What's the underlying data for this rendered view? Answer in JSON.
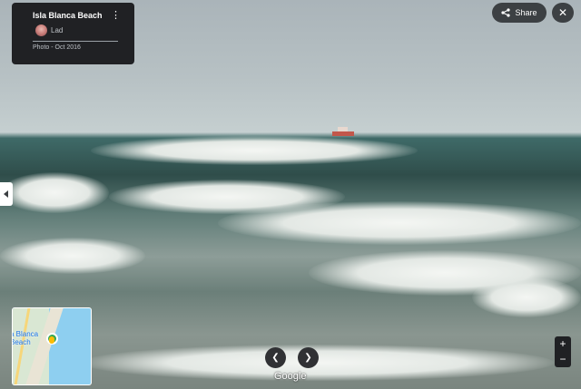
{
  "place": {
    "title": "Isla Blanca Beach",
    "author": "Lad",
    "photo_meta": "Photo - Oct 2016"
  },
  "icons": {
    "menu": "more-vert-icon",
    "share": "share-icon",
    "close": "close-icon",
    "collapse": "chevron-left-icon",
    "prev": "chevron-left-icon",
    "next": "chevron-right-icon"
  },
  "toolbar": {
    "share_label": "Share",
    "close_glyph": "✕",
    "menu_glyph": "⋮"
  },
  "minimap": {
    "label_line1": "a Blanca",
    "label_line2": "Beach"
  },
  "nav": {
    "prev_glyph": "❮",
    "next_glyph": "❯"
  },
  "branding": {
    "watermark": "Google"
  },
  "zoom": {
    "in_glyph": "+",
    "out_glyph": "−"
  },
  "colors": {
    "panel": "#202124",
    "button": "#3c4043",
    "map_water": "#8ecff0",
    "pin": "#34a853"
  }
}
